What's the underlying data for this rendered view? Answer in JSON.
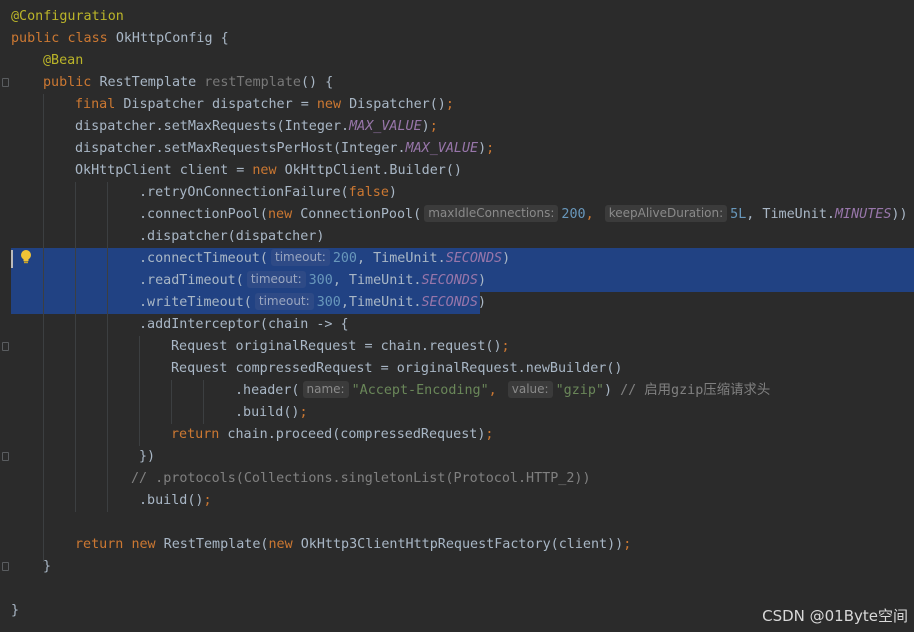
{
  "code": {
    "l1_annotation": "@Configuration",
    "l2_public": "public",
    "l2_class": "class",
    "l2_name": "OkHttpConfig",
    "l2_brace": " {",
    "l3_annotation": "@Bean",
    "l4_public": "public",
    "l4_type": "RestTemplate",
    "l4_method": "restTemplate",
    "l4_rest": "() {",
    "l5_final": "final",
    "l5_decl": "Dispatcher dispatcher = ",
    "l5_new": "new",
    "l5_ctor": " Dispatcher()",
    "l5_semi": ";",
    "l6_call": "dispatcher.setMaxRequests(Integer.",
    "l6_const": "MAX_VALUE",
    "l6_end": ")",
    "l6_semi": ";",
    "l7_call": "dispatcher.setMaxRequestsPerHost(Integer.",
    "l7_const": "MAX_VALUE",
    "l7_end": ")",
    "l7_semi": ";",
    "l8_decl": "OkHttpClient client = ",
    "l8_new": "new",
    "l8_ctor": " OkHttpClient.Builder()",
    "l9_call": ".retryOnConnectionFailure(",
    "l9_false": "false",
    "l9_end": ")",
    "l10_call": ".connectionPool(",
    "l10_new": "new",
    "l10_ctor": " ConnectionPool(",
    "l10_hint1": "maxIdleConnections:",
    "l10_num1": "200",
    "l10_comma": ",",
    "l10_hint2": "keepAliveDuration:",
    "l10_num2": "5L",
    "l10_mid": ", TimeUnit.",
    "l10_const": "MINUTES",
    "l10_end": "))",
    "l11_call": ".dispatcher(dispatcher)",
    "l12_call": ".connectTimeout(",
    "l12_hint": "timeout:",
    "l12_num": "200",
    "l12_mid": ", TimeUnit.",
    "l12_const": "SECONDS",
    "l12_end": ")",
    "l13_call": ".readTimeout(",
    "l13_hint": "timeout:",
    "l13_num": "300",
    "l13_mid": ", TimeUnit.",
    "l13_const": "SECONDS",
    "l13_end": ")",
    "l14_call": ".writeTimeout(",
    "l14_hint": "timeout:",
    "l14_num": "300",
    "l14_mid": ",TimeUnit.",
    "l14_const": "SECONDS",
    "l14_end": ")",
    "l15_call": ".addInterceptor(chain -> {",
    "l16_decl": "Request originalRequest = chain.request()",
    "l16_semi": ";",
    "l17_decl": "Request compressedRequest = originalRequest.newBuilder()",
    "l18_call": ".header(",
    "l18_hint1": "name:",
    "l18_str1": "\"Accept-Encoding\"",
    "l18_comma": ",",
    "l18_hint2": "value:",
    "l18_str2": "\"gzip\"",
    "l18_end": ") ",
    "l18_comment": "// 启用gzip压缩请求头",
    "l19_call": ".build()",
    "l19_semi": ";",
    "l20_return": "return",
    "l20_call": " chain.proceed(compressedRequest)",
    "l20_semi": ";",
    "l21_close": "})",
    "l22_comment": "// .protocols(Collections.singletonList(Protocol.HTTP_2))",
    "l23_call": ".build()",
    "l23_semi": ";",
    "l25_return": "return",
    "l25_new1": "new",
    "l25_mid": " RestTemplate(",
    "l25_new2": "new",
    "l25_end": " OkHttp3ClientHttpRequestFactory(client))",
    "l25_semi": ";",
    "l26_close": "}",
    "l28_close": "}"
  },
  "watermark": "CSDN @01Byte空间",
  "colors": {
    "background": "#2b2b2b",
    "selection": "#214283",
    "keyword": "#cc7832",
    "annotation": "#bbb529",
    "method_decl": "#ffc66d",
    "constant": "#9876aa",
    "number": "#6897bb",
    "string": "#6a8759",
    "comment": "#808080"
  },
  "icons": {
    "gutter_bulb": "lightbulb-icon",
    "fold_marker": "fold-marker-icon"
  }
}
